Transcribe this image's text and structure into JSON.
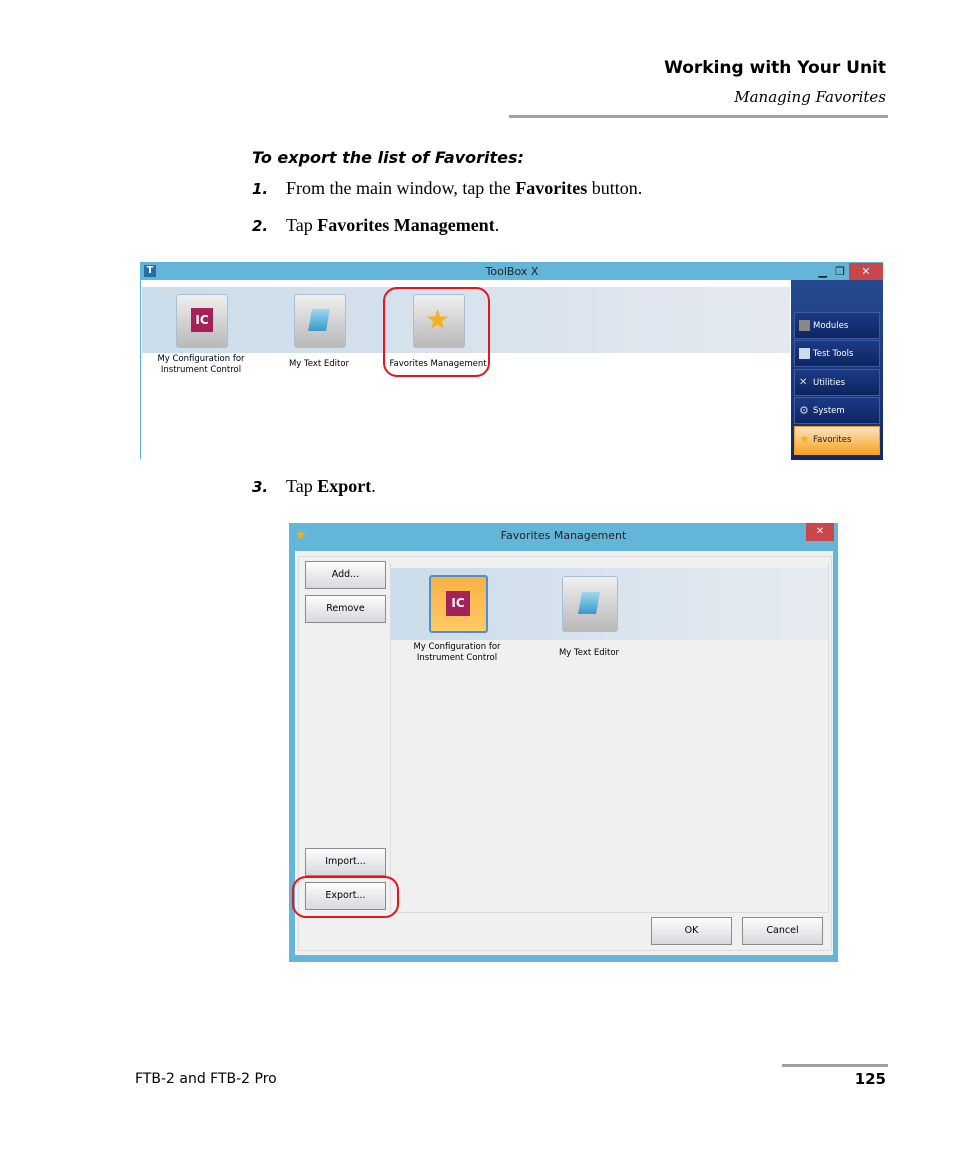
{
  "header": {
    "chapter": "Working with Your Unit",
    "section": "Managing Favorites"
  },
  "procedure_title": "To export the list of Favorites:",
  "steps": [
    {
      "num": "1.",
      "pre": "From the main window, tap the ",
      "bold": "Favorites",
      "post": " button."
    },
    {
      "num": "2.",
      "pre": "Tap ",
      "bold": "Favorites Management",
      "post": "."
    },
    {
      "num": "3.",
      "pre": "Tap ",
      "bold": "Export",
      "post": "."
    }
  ],
  "toolbox": {
    "title": "ToolBox X",
    "tiles": [
      {
        "label": "My Configuration for Instrument Control",
        "icon": "ic-icon"
      },
      {
        "label": "My Text Editor",
        "icon": "notepad-icon"
      },
      {
        "label": "Favorites Management",
        "icon": "star-icon"
      }
    ],
    "nav": [
      {
        "label": "Modules"
      },
      {
        "label": "Test Tools"
      },
      {
        "label": "Utilities"
      },
      {
        "label": "System Settings"
      },
      {
        "label": "Favorites",
        "active": true
      }
    ]
  },
  "dialog": {
    "title": "Favorites Management",
    "add": "Add...",
    "remove": "Remove",
    "import": "Import...",
    "export": "Export...",
    "ok": "OK",
    "cancel": "Cancel",
    "tiles": [
      {
        "label": "My Configuration for Instrument Control",
        "selected": true
      },
      {
        "label": "My Text Editor"
      }
    ]
  },
  "footer": {
    "product": "FTB-2 and FTB-2 Pro",
    "page": "125"
  },
  "colors": {
    "highlight": "#e3161b",
    "titlebar": "#63b6d8",
    "nav": "#13307a",
    "active": "#f9a21b"
  }
}
